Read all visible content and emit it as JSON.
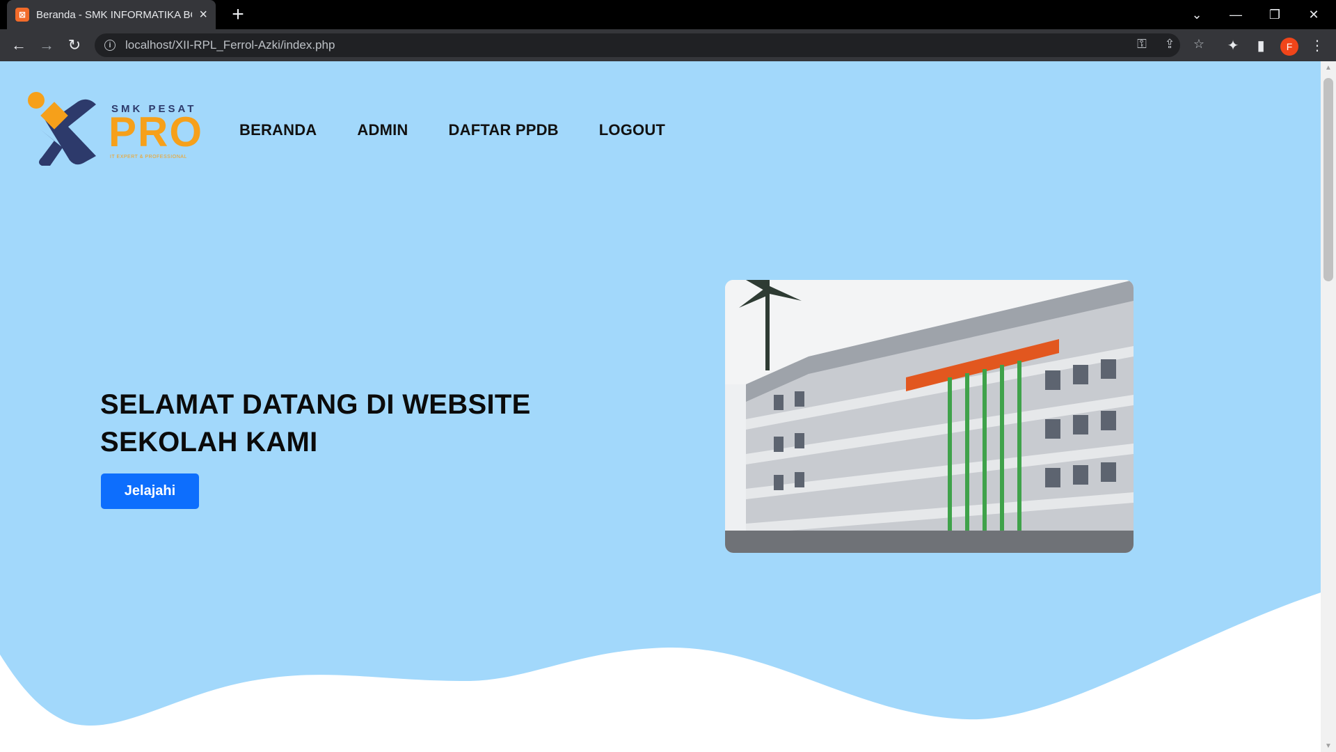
{
  "browser": {
    "tab_title": "Beranda - SMK INFORMATIKA BO",
    "favicon_glyph": "⊠",
    "url": "localhost/XII-RPL_Ferrol-Azki/index.php",
    "profile_initial": "F"
  },
  "logo": {
    "top_text": "SMK PESAT",
    "main_text": "PRO",
    "tagline": "IT EXPERT & PROFESSIONAL"
  },
  "nav": {
    "items": [
      {
        "label": "BERANDA"
      },
      {
        "label": "ADMIN"
      },
      {
        "label": "DAFTAR PPDB"
      },
      {
        "label": "LOGOUT"
      }
    ]
  },
  "hero": {
    "title": "SELAMAT DATANG DI WEBSITE SEKOLAH KAMI",
    "button_label": "Jelajahi"
  },
  "colors": {
    "hero_bg": "#a2d8fb",
    "button": "#0d6efd",
    "logo_navy": "#2d3a6b",
    "logo_orange": "#f6a01a"
  }
}
